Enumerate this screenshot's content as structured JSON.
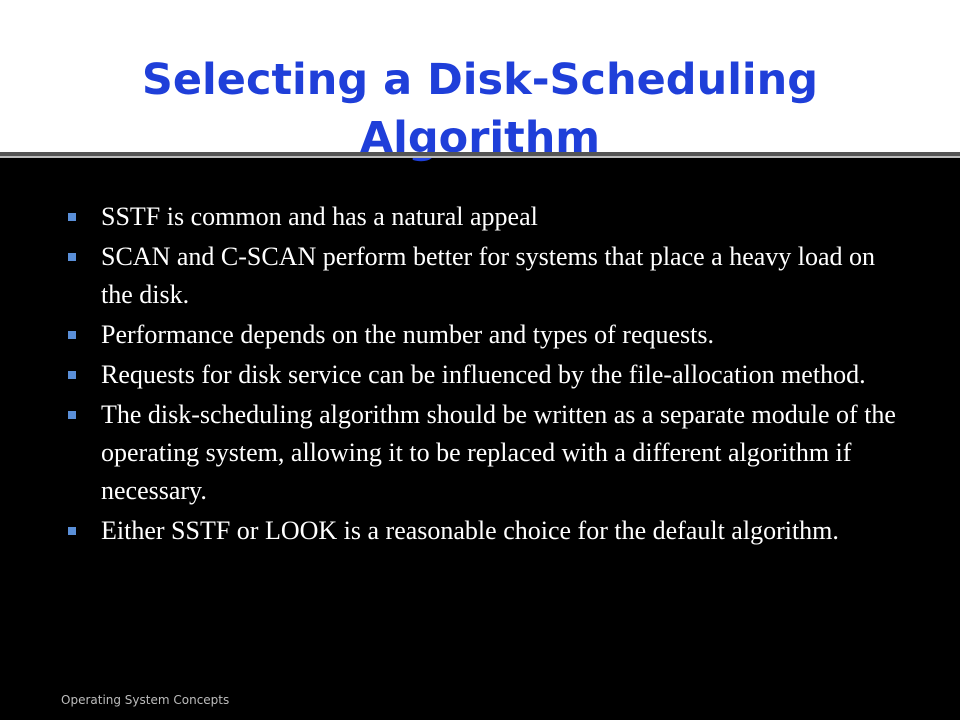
{
  "title": {
    "line1": "Selecting a Disk-Scheduling",
    "line2": "Algorithm"
  },
  "bullets": [
    "SSTF is common and has a natural appeal",
    "SCAN and C-SCAN perform better for systems that place a heavy load on the disk.",
    "Performance depends on the number and types of requests.",
    "Requests for disk service can be influenced by the file-allocation method.",
    "The disk-scheduling algorithm should be written as a separate module of the operating system, allowing it to be replaced with a different algorithm if necessary.",
    "Either SSTF or LOOK is a reasonable choice for the default algorithm."
  ],
  "footer": "Operating System Concepts",
  "colors": {
    "title": "#1f3fd9",
    "background": "#000000",
    "bullet": "#5a8fd8",
    "text": "#ffffff"
  }
}
